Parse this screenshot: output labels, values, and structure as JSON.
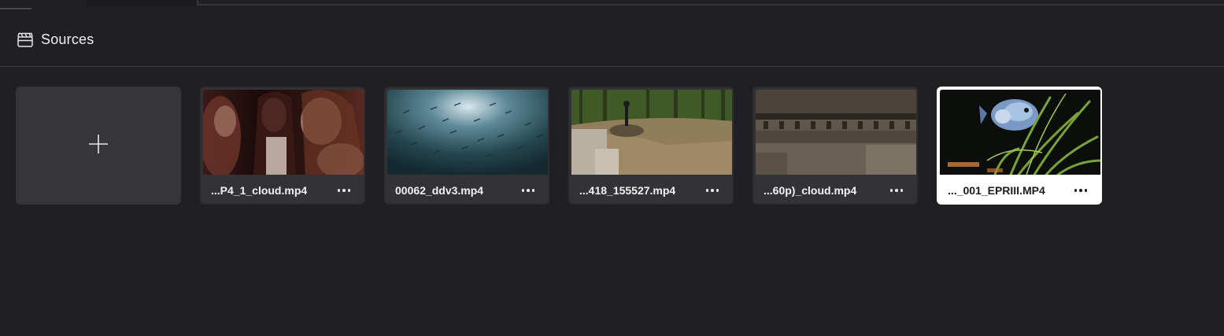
{
  "panel": {
    "title": "Sources",
    "icon": "clapperboard-icon"
  },
  "add_tile": {
    "icon": "plus-icon"
  },
  "media": [
    {
      "name": "...P4_1_cloud.mp4",
      "selected": false
    },
    {
      "name": "00062_ddv3.mp4",
      "selected": false
    },
    {
      "name": "...418_155527.mp4",
      "selected": false
    },
    {
      "name": "...60p)_cloud.mp4",
      "selected": false
    },
    {
      "name": "..._001_EPRIII.MP4",
      "selected": true
    }
  ],
  "colors": {
    "background": "#202023",
    "card": "#333337",
    "selected_card": "#ffffff"
  }
}
